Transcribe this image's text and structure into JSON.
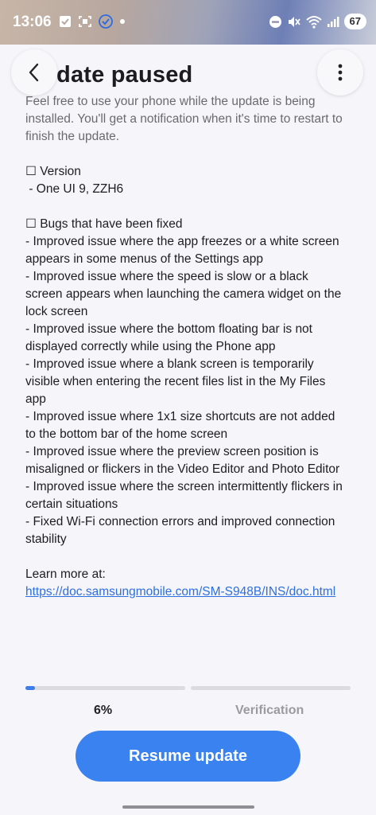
{
  "status_bar": {
    "time": "13:06",
    "battery": "67"
  },
  "header": {
    "title": "Update paused"
  },
  "content": {
    "intro": "Feel free to use your phone while the update is being installed. You'll get a notification when it's time to restart to finish the update.",
    "version_heading": "☐ Version",
    "version_value": " - One UI 9, ZZH6",
    "bugs_heading": "☐ Bugs that have been fixed",
    "bugs": [
      "- Improved issue where the app freezes or a white screen appears in some menus of the Settings app",
      "- Improved issue where the speed is slow or a black screen appears when launching the camera widget on the lock screen",
      "- Improved issue where the bottom floating bar is not displayed correctly while using the Phone app",
      "- Improved issue where a blank screen is temporarily visible when entering the recent files list in the My Files app",
      "- Improved issue where 1x1 size shortcuts are not added to the bottom bar of the home screen",
      "- Improved issue where the preview screen position is misaligned or flickers in the Video Editor and Photo Editor",
      "- Improved issue where the screen intermittently flickers in certain situations",
      "- Fixed Wi-Fi connection errors and improved connection stability"
    ],
    "learn_more": "Learn more at:",
    "link": "https://doc.samsungmobile.com/SM-S948B/INS/doc.html"
  },
  "progress": {
    "percent_label": "6%",
    "percent_value": 6,
    "step2_label": "Verification"
  },
  "actions": {
    "resume_label": "Resume update"
  },
  "colors": {
    "accent": "#3b82f1",
    "link": "#2e6fe0"
  }
}
